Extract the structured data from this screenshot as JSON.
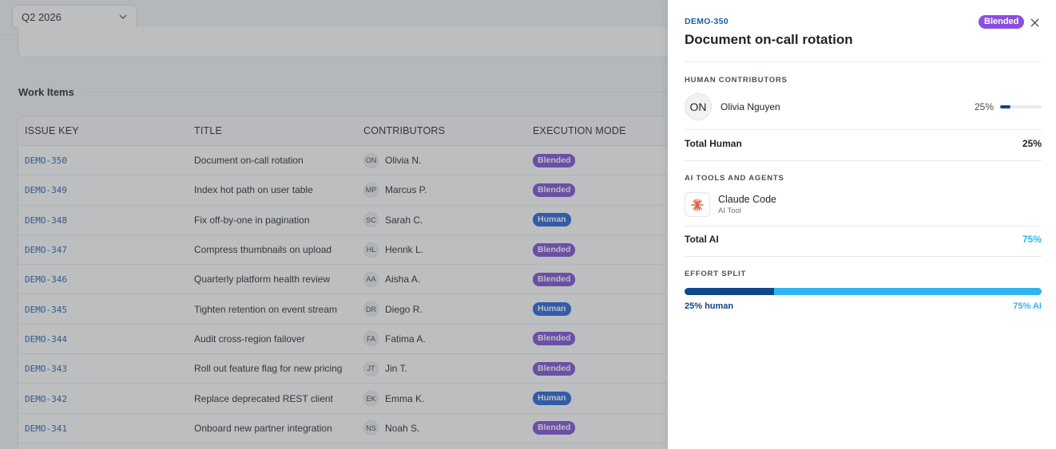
{
  "filter": {
    "quarter": "Q2 2026"
  },
  "section": {
    "title": "Work Items"
  },
  "table": {
    "headers": [
      "ISSUE KEY",
      "TITLE",
      "CONTRIBUTORS",
      "EXECUTION MODE"
    ],
    "rows": [
      {
        "key": "DEMO-350",
        "title": "Document on-call rotation",
        "initials": "ON",
        "contributor": "Olivia N.",
        "mode": "Blended"
      },
      {
        "key": "DEMO-349",
        "title": "Index hot path on user table",
        "initials": "MP",
        "contributor": "Marcus P.",
        "mode": "Blended"
      },
      {
        "key": "DEMO-348",
        "title": "Fix off-by-one in pagination",
        "initials": "SC",
        "contributor": "Sarah C.",
        "mode": "Human"
      },
      {
        "key": "DEMO-347",
        "title": "Compress thumbnails on upload",
        "initials": "HL",
        "contributor": "Henrik L.",
        "mode": "Blended"
      },
      {
        "key": "DEMO-346",
        "title": "Quarterly platform health review",
        "initials": "AA",
        "contributor": "Aisha A.",
        "mode": "Blended"
      },
      {
        "key": "DEMO-345",
        "title": "Tighten retention on event stream",
        "initials": "DR",
        "contributor": "Diego R.",
        "mode": "Human"
      },
      {
        "key": "DEMO-344",
        "title": "Audit cross-region failover",
        "initials": "FA",
        "contributor": "Fatima A.",
        "mode": "Blended"
      },
      {
        "key": "DEMO-343",
        "title": "Roll out feature flag for new pricing",
        "initials": "JT",
        "contributor": "Jin T.",
        "mode": "Blended"
      },
      {
        "key": "DEMO-342",
        "title": "Replace deprecated REST client",
        "initials": "EK",
        "contributor": "Emma K.",
        "mode": "Human"
      },
      {
        "key": "DEMO-341",
        "title": "Onboard new partner integration",
        "initials": "NS",
        "contributor": "Noah S.",
        "mode": "Blended"
      }
    ]
  },
  "drawer": {
    "issue_key": "DEMO-350",
    "title": "Document on-call rotation",
    "badge": "Blended",
    "close_icon": "close-icon",
    "human_caption": "HUMAN CONTRIBUTORS",
    "human": {
      "initials": "ON",
      "name": "Olivia Nguyen",
      "pct_label": "25%",
      "pct": 25
    },
    "total_human_label": "Total Human",
    "total_human_value": "25%",
    "ai_caption": "AI TOOLS AND AGENTS",
    "ai_tool": {
      "name": "Claude Code",
      "type": "AI Tool",
      "icon": "claude-code-icon"
    },
    "total_ai_label": "Total AI",
    "total_ai_value": "75%",
    "split_caption": "EFFORT SPLIT",
    "split": {
      "human_pct": 25,
      "ai_pct": 75,
      "human_label": "25% human",
      "ai_label": "75% AI"
    }
  },
  "colors": {
    "human_dark": "#10468a",
    "ai_light": "#2fb4ef",
    "blended": "#7c4dd6",
    "human_badge": "#2162d9",
    "accent_orange": "#d9663f"
  }
}
